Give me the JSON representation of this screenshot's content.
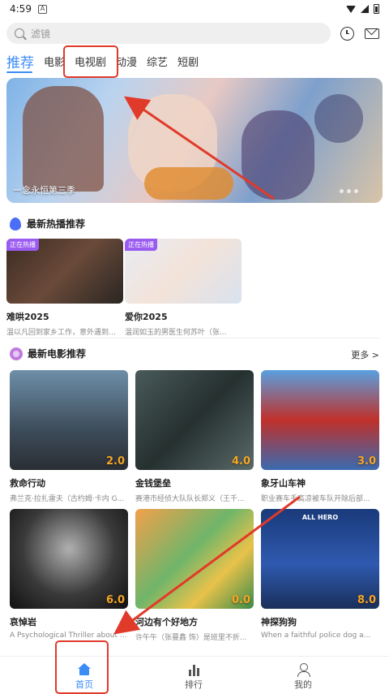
{
  "status_bar": {
    "time": "4:59",
    "notif_badge": "A"
  },
  "search": {
    "placeholder": "滤镜"
  },
  "tabs": [
    {
      "label": "推荐",
      "active": true
    },
    {
      "label": "电影"
    },
    {
      "label": "电视剧"
    },
    {
      "label": "动漫"
    },
    {
      "label": "综艺"
    },
    {
      "label": "短剧"
    }
  ],
  "banner": {
    "caption": "一念永恒第三季"
  },
  "hot_section": {
    "title": "最新热播推荐",
    "items": [
      {
        "badge": "正在热播",
        "title": "难哄2025",
        "desc": "温以凡回到家乡工作，意外遇到高中..."
      },
      {
        "badge": "正在热播",
        "title": "爱你2025",
        "desc": "温润如玉的男医生何苏叶（张..."
      }
    ]
  },
  "movie_section": {
    "title": "最新电影推荐",
    "more": "更多 >",
    "items": [
      {
        "title": "救命行动",
        "desc": "弗兰克·拉扎雷夫（古约姆·卡内 G...",
        "rating": "2.0"
      },
      {
        "title": "金钱堡垒",
        "desc": "赛港市经侦大队队长郑义（王千...",
        "rating": "4.0"
      },
      {
        "title": "象牙山车神",
        "desc": "职业赛车手高凉被车队开除后部...",
        "rating": "3.0"
      },
      {
        "title": "哀悼岩",
        "desc": "A Psychological Thriller about a s...",
        "rating": "6.0"
      },
      {
        "title": "河边有个好地方",
        "desc": "许午午（张蔓鑫 饰）是班里不折...",
        "rating": "0.0"
      },
      {
        "title": "神探狗狗",
        "desc": "When a faithful police dog a...",
        "rating": "8.0",
        "poster_text": "ALL HERO"
      }
    ]
  },
  "bottom_nav": [
    {
      "label": "首页",
      "active": true
    },
    {
      "label": "排行"
    },
    {
      "label": "我的"
    }
  ],
  "colors": {
    "accent": "#3b8cf6",
    "annotation": "#e03a2a",
    "rating": "#f5a623",
    "badge": "#9a5bf0"
  }
}
